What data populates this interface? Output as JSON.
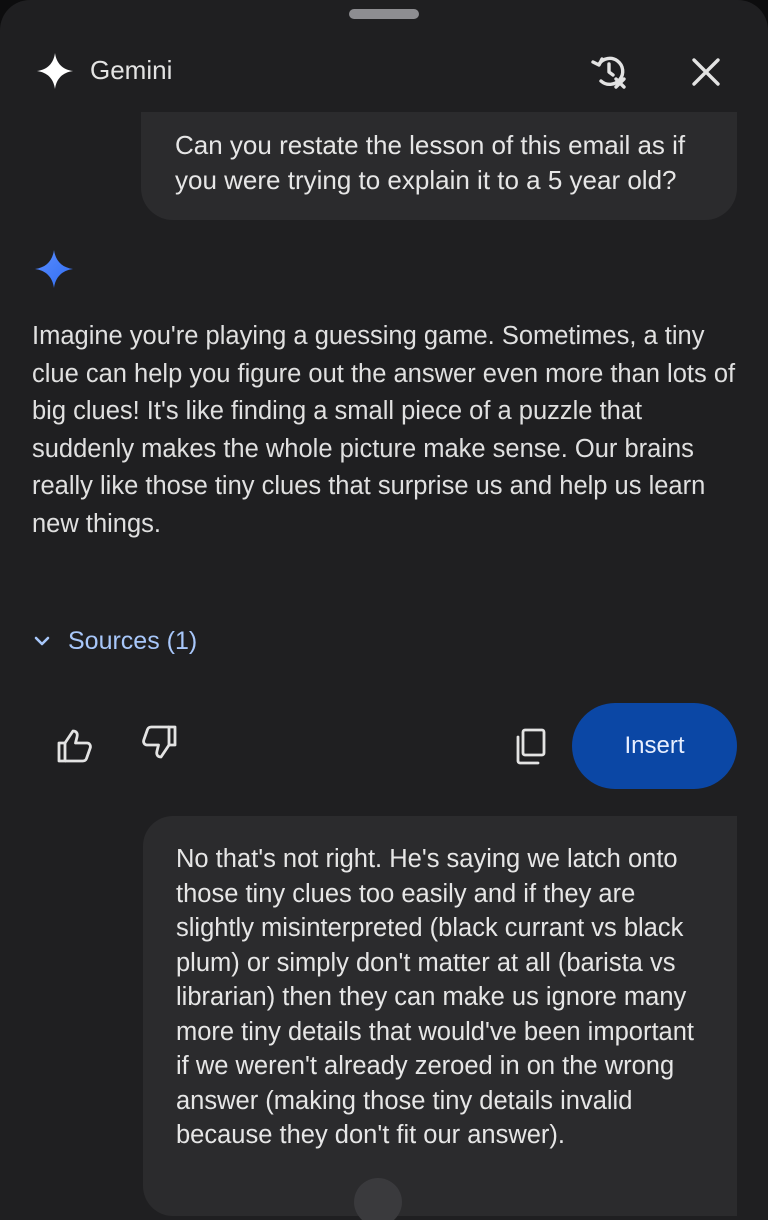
{
  "app": {
    "title": "Gemini",
    "accent_color": "#a8c7fa",
    "background_color": "#1f1f21"
  },
  "header": {
    "icons": [
      "gemini-sparkle-icon",
      "history-off-icon",
      "close-icon"
    ]
  },
  "conversation": {
    "user_message_1": "Can you restate the lesson of this email as if you were trying to explain it to a 5 year old?",
    "assistant_response": "Imagine you're playing a guessing game. Sometimes, a tiny clue can help you figure out the answer even more than lots of big clues! It's like finding a small piece of a puzzle that suddenly makes the whole picture make sense. Our brains really like those tiny clues that surprise us and help us learn new things.",
    "sources_label": "Sources (1)",
    "actions": {
      "insert_label": "Insert",
      "icons": [
        "thumbs-up-icon",
        "thumbs-down-icon",
        "copy-icon"
      ],
      "insert_color": "#0b47a5"
    },
    "user_message_2": "No that's not right. He's saying we latch onto those tiny clues too easily and if they are slightly misinterpreted (black currant vs black plum) or simply don't matter at all (barista vs librarian) then they can make us ignore many more tiny details that would've been important if we weren't already zeroed in on the wrong answer (making those tiny details invalid because they don't fit our answer)."
  }
}
